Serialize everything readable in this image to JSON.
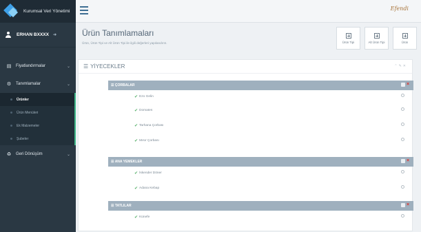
{
  "brand": {
    "name": "Kurumsal Veri Yönetimi"
  },
  "user": {
    "name": "ERHAN BXXXX"
  },
  "sidebar": {
    "items": [
      {
        "label": "Fiyatlandırmalar",
        "icon": "table-icon"
      },
      {
        "label": "Tanımlamalar",
        "icon": "cogs-icon"
      },
      {
        "label": "Geri Dönüşüm",
        "icon": "recycle-icon"
      }
    ],
    "submenu": [
      {
        "label": "Ürünler",
        "active": true
      },
      {
        "label": "Ürün Menüleri",
        "active": false
      },
      {
        "label": "Ek Malzemeler",
        "active": false
      },
      {
        "label": "Şubeler",
        "active": false
      }
    ]
  },
  "topbar": {
    "logo": "Efendi"
  },
  "page": {
    "title": "Ürün Tanımlamaları",
    "subtitle": "Ürün, Ürün Tipi ve Alt Ürün Tipi ile ilgili değerleri yapılandırın."
  },
  "actions": [
    {
      "label": "Ürün Tipi"
    },
    {
      "label": "Alt Ürün Tipi"
    },
    {
      "label": "Ürün"
    }
  ],
  "panel": {
    "title": "YİYECEKLER",
    "categories": [
      {
        "name": "ÇORBALAR",
        "items": [
          "Ezo Gelin",
          "Domates",
          "Tarhana Çorbası",
          "Mısır Çorbası"
        ]
      },
      {
        "name": "ANA YEMEKLER",
        "items": [
          "İskender Döner",
          "Adana Kebap"
        ]
      },
      {
        "name": "TATLILAR",
        "items": [
          "Künefe"
        ]
      }
    ]
  },
  "colors": {
    "sidebar": "#2a3843",
    "category_bar": "#9fb0be",
    "active_border": "#3fb98a",
    "check": "#56b06a",
    "delete": "#e0302a"
  }
}
